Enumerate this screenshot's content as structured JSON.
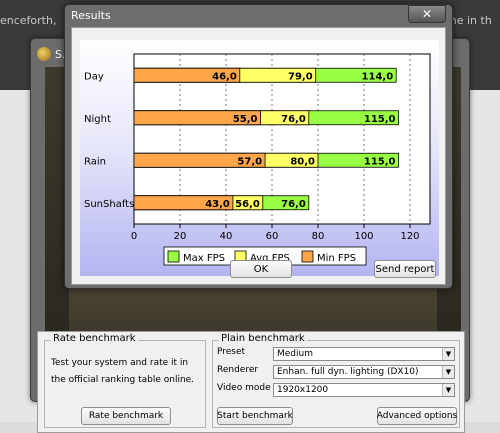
{
  "background": {
    "left_text": "enceforth,",
    "right_text": "me in th"
  },
  "back_window": {
    "title_fragment": "S."
  },
  "results_window": {
    "title": "Results",
    "close_glyph": "✕",
    "ok_label": "OK",
    "send_label": "Send report"
  },
  "chart_data": {
    "type": "bar",
    "orientation": "horizontal",
    "stacked": true,
    "categories": [
      "Day",
      "Night",
      "Rain",
      "SunShafts"
    ],
    "series": [
      {
        "name": "Min FPS",
        "color": "#ffa64a",
        "values": [
          46.0,
          55.0,
          57.0,
          43.0
        ],
        "labels": [
          "46,0",
          "55,0",
          "57,0",
          "43,0"
        ]
      },
      {
        "name": "Avg FPS",
        "color": "#ffff66",
        "values": [
          79.0,
          76.0,
          80.0,
          56.0
        ],
        "labels": [
          "79,0",
          "76,0",
          "80,0",
          "56,0"
        ]
      },
      {
        "name": "Max FPS",
        "color": "#99ff44",
        "values": [
          114.0,
          115.0,
          115.0,
          76.0
        ],
        "labels": [
          "114,0",
          "115,0",
          "115,0",
          "76,0"
        ]
      }
    ],
    "legend_order": [
      "Max FPS",
      "Avg FPS",
      "Min FPS"
    ],
    "xlim": [
      0,
      120
    ],
    "xticks": [
      "0",
      "20",
      "40",
      "60",
      "80",
      "100",
      "120"
    ],
    "grid": true,
    "legend_position": "bottom"
  },
  "rate_benchmark": {
    "legend": "Rate benchmark",
    "description": "Test your system and rate it in the official ranking table online.",
    "button": "Rate benchmark"
  },
  "plain_benchmark": {
    "legend": "Plain benchmark",
    "preset_label": "Preset",
    "preset_value": "Medium",
    "renderer_label": "Renderer",
    "renderer_value": "Enhan. full dyn. lighting (DX10)",
    "video_label": "Video mode",
    "video_value": "1920x1200",
    "start_button": "Start benchmark",
    "advanced_button": "Advanced options"
  }
}
